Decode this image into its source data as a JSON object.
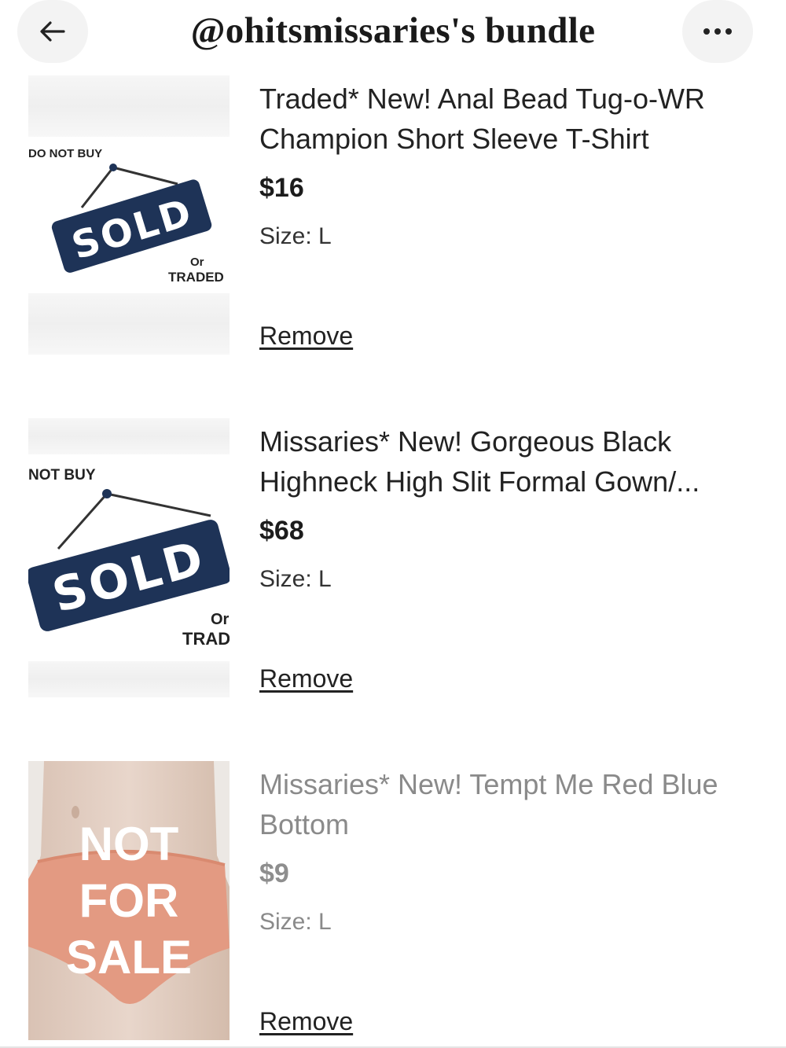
{
  "header": {
    "title": "@ohitsmissaries's bundle",
    "back_icon": "arrow-left-icon",
    "more_icon": "ellipsis-icon"
  },
  "items": [
    {
      "title": "Traded* New! Anal Bead Tug-o-WR Champion Short Sleeve T-Shirt",
      "price": "$16",
      "size": "Size: L",
      "remove_label": "Remove",
      "badge": {
        "top_text": "DO NOT BUY",
        "sign_text": "SOLD",
        "or_text": "Or",
        "traded_text": "TRADED"
      }
    },
    {
      "title": "Missaries* New! Gorgeous Black Highneck High Slit Formal Gown/...",
      "price": "$68",
      "size": "Size: L",
      "remove_label": "Remove",
      "badge": {
        "top_text": "NOT BUY",
        "sign_text": "SOLD",
        "or_text": "Or",
        "traded_text": "TRAD"
      }
    },
    {
      "title": "Missaries* New! Tempt Me Red Blue Bottom",
      "price": "$9",
      "size": "Size: L",
      "remove_label": "Remove",
      "badge": {
        "line1": "NOT",
        "line2": "FOR",
        "line3": "SALE"
      }
    }
  ],
  "colors": {
    "sign_navy": "#1e3357",
    "accent_text": "#222222",
    "muted_text": "#8a8a8a"
  }
}
